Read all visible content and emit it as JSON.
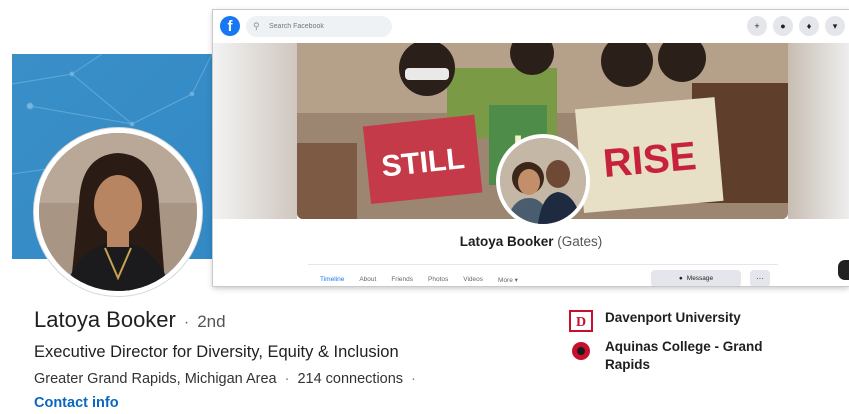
{
  "linkedin": {
    "name": "Latoya Booker",
    "degree": "2nd",
    "headline": "Executive Director for Diversity, Equity & Inclusion",
    "location": "Greater Grand Rapids, Michigan Area",
    "connections": "214 connections",
    "contact_info": "Contact info",
    "education": [
      {
        "name": "Davenport University",
        "logo": "davenport-logo",
        "color": "#c8102e"
      },
      {
        "name": "Aquinas College - Grand Rapids",
        "logo": "aquinas-logo",
        "color": "#c8102e"
      }
    ],
    "banner_color": "#2f86c4"
  },
  "facebook": {
    "search_placeholder": "Search Facebook",
    "cover_words": [
      "STILL",
      "I",
      "RISE"
    ],
    "profile_name": "Latoya Booker",
    "alt_name": "(Gates)",
    "tabs": [
      "Timeline",
      "About",
      "Friends",
      "Photos",
      "Videos",
      "More ▾"
    ],
    "active_tab": "Timeline",
    "message_button": "Message",
    "more_button": "···",
    "brand_color": "#1877f2"
  }
}
